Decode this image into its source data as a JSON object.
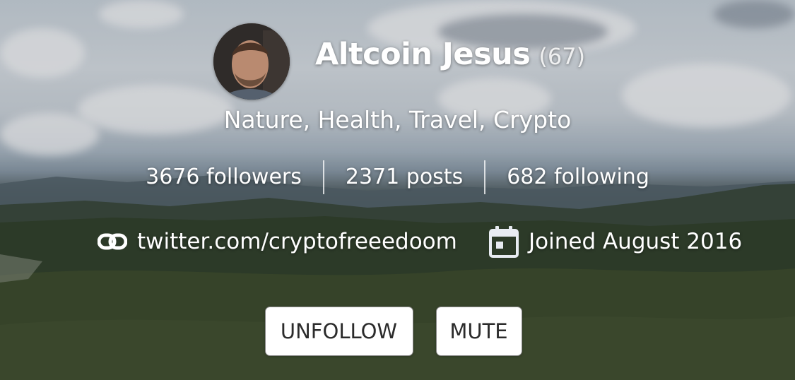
{
  "profile": {
    "name": "Altcoin Jesus",
    "reputation": "(67)",
    "about": "Nature, Health, Travel, Crypto",
    "avatar_alt": "avatar"
  },
  "stats": {
    "followers": "3676 followers",
    "posts": "2371 posts",
    "following": "682 following"
  },
  "meta": {
    "website": "twitter.com/cryptofreeedoom",
    "joined": "Joined August 2016",
    "link_icon": "link-icon",
    "calendar_icon": "calendar-icon"
  },
  "actions": {
    "unfollow_label": "UNFOLLOW",
    "mute_label": "MUTE"
  },
  "colors": {
    "text": "#ffffff",
    "button_bg": "#ffffff",
    "button_text": "#2b2b2b",
    "calendar_icon": "#e8ecf2"
  }
}
